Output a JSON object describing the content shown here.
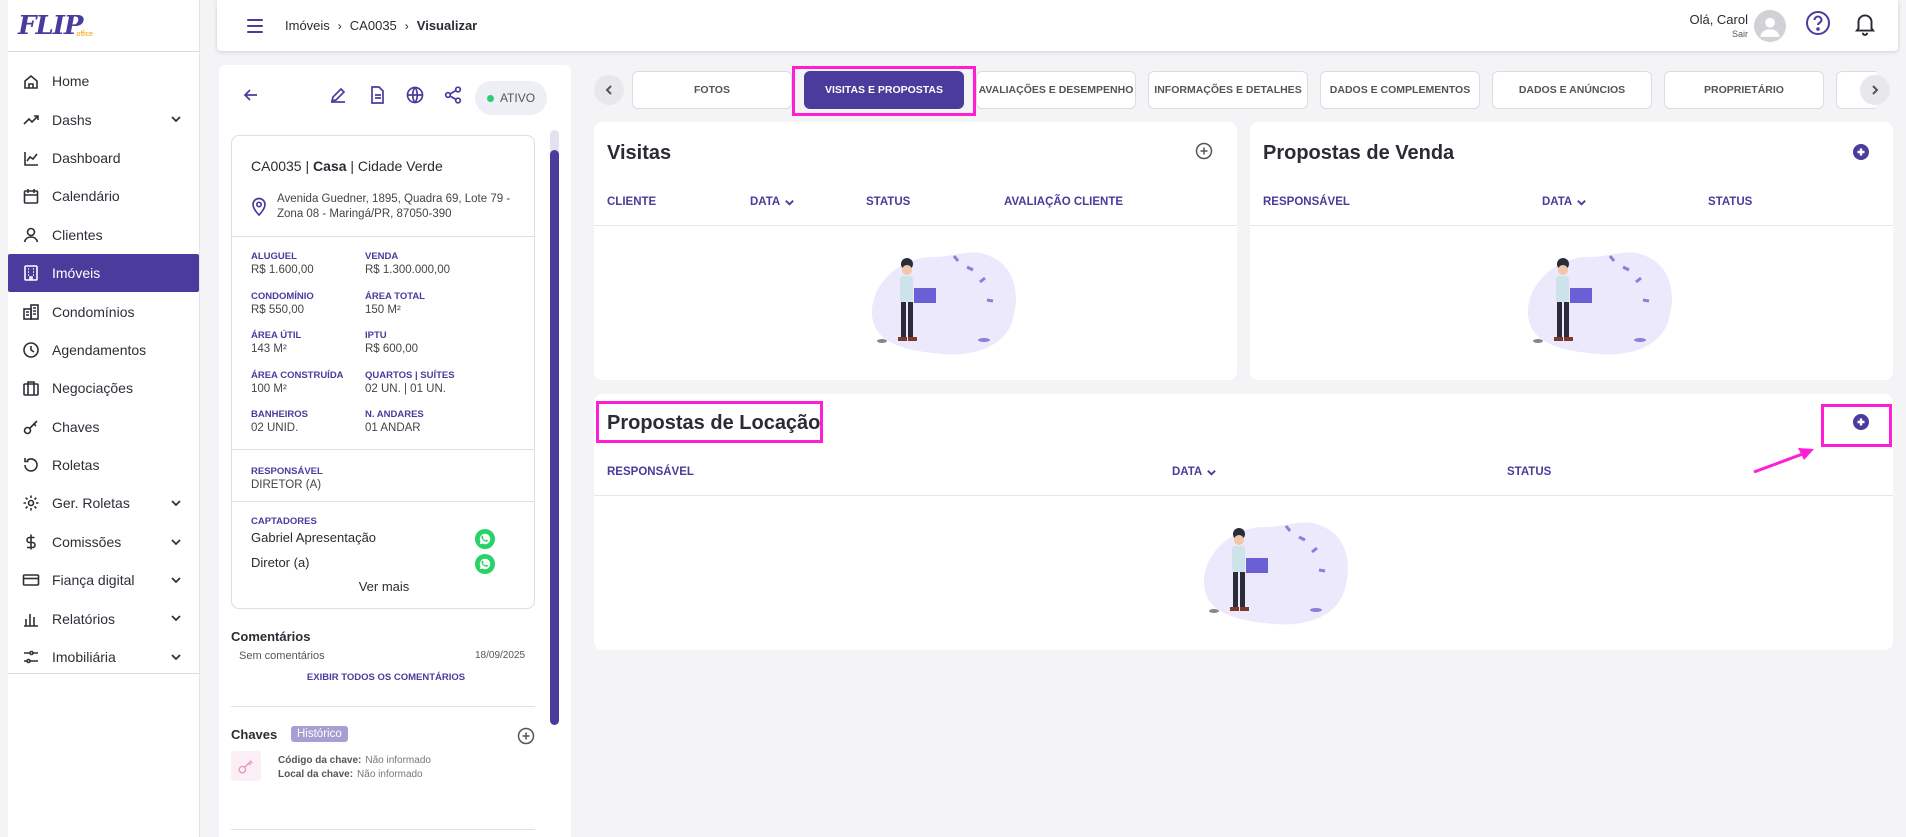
{
  "app": {
    "logo_text": "FLIP",
    "logo_sub": "office"
  },
  "sidebar": {
    "items": [
      {
        "label": "Home",
        "icon": "home-icon",
        "has_submenu": false
      },
      {
        "label": "Dashs",
        "icon": "trend-icon",
        "has_submenu": true
      },
      {
        "label": "Dashboard",
        "icon": "chart-icon",
        "has_submenu": false
      },
      {
        "label": "Calendário",
        "icon": "calendar-icon",
        "has_submenu": false
      },
      {
        "label": "Clientes",
        "icon": "user-icon",
        "has_submenu": false
      },
      {
        "label": "Imóveis",
        "icon": "building-icon",
        "has_submenu": false,
        "active": true
      },
      {
        "label": "Condomínios",
        "icon": "condo-icon",
        "has_submenu": false
      },
      {
        "label": "Agendamentos",
        "icon": "clock-icon",
        "has_submenu": false
      },
      {
        "label": "Negociações",
        "icon": "briefcase-icon",
        "has_submenu": false
      },
      {
        "label": "Chaves",
        "icon": "key-icon",
        "has_submenu": false
      },
      {
        "label": "Roletas",
        "icon": "rotate-icon",
        "has_submenu": false
      },
      {
        "label": "Ger. Roletas",
        "icon": "gear-icon",
        "has_submenu": true
      },
      {
        "label": "Comissões",
        "icon": "dollar-icon",
        "has_submenu": true
      },
      {
        "label": "Fiança digital",
        "icon": "card-icon",
        "has_submenu": true
      },
      {
        "label": "Relatórios",
        "icon": "bar-chart-icon",
        "has_submenu": true
      },
      {
        "label": "Imobiliária",
        "icon": "settings-icon",
        "has_submenu": true
      }
    ]
  },
  "header": {
    "breadcrumb": [
      "Imóveis",
      "CA0035",
      "Visualizar"
    ],
    "greeting": "Olá, Carol",
    "logout": "Sair"
  },
  "property": {
    "status": "ATIVO",
    "code": "CA0035",
    "type": "Casa",
    "condo": "Cidade Verde",
    "address": "Avenida Guedner, 1895, Quadra 69, Lote 79 - Zona 08 - Maringá/PR, 87050-390",
    "attributes": [
      {
        "label": "Aluguel",
        "value": "R$ 1.600,00"
      },
      {
        "label": "Venda",
        "value": "R$ 1.300.000,00"
      },
      {
        "label": "Condomínio",
        "value": "R$ 550,00"
      },
      {
        "label": "Área total",
        "value": "150 M²"
      },
      {
        "label": "Área útil",
        "value": "143 M²"
      },
      {
        "label": "IPTU",
        "value": "R$ 600,00"
      },
      {
        "label": "Área construída",
        "value": "100 M²"
      },
      {
        "label": "Quartos | Suítes",
        "value": "02 UN. | 01 UN."
      },
      {
        "label": "Banheiros",
        "value": "02 UNID."
      },
      {
        "label": "N. Andares",
        "value": "01 ANDAR"
      }
    ],
    "responsavel_label": "RESPONSÁVEL",
    "responsavel": "DIRETOR (A)",
    "captadores_label": "CAPTADORES",
    "captadores": [
      "Gabriel Apresentação",
      "Diretor (a)"
    ],
    "ver_mais": "Ver mais"
  },
  "comments": {
    "title": "Comentários",
    "empty": "Sem comentários",
    "date": "18/09/2025",
    "show_all": "EXIBIR TODOS OS COMENTÁRIOS"
  },
  "keys": {
    "title": "Chaves",
    "history_badge": "Histórico",
    "code_label": "Código da chave:",
    "code_value": "Não informado",
    "local_label": "Local da chave:",
    "local_value": "Não informado"
  },
  "tabs": [
    {
      "label": "FOTOS"
    },
    {
      "label": "VISITAS E PROPOSTAS",
      "active": true
    },
    {
      "label": "AVALIAÇÕES E DESEMPENHO"
    },
    {
      "label": "INFORMAÇÕES E DETALHES"
    },
    {
      "label": "DADOS E COMPLEMENTOS"
    },
    {
      "label": "DADOS E ANÚNCIOS"
    },
    {
      "label": "PROPRIETÁRIO"
    }
  ],
  "visitas": {
    "title": "Visitas",
    "columns": [
      "CLIENTE",
      "DATA",
      "STATUS",
      "AVALIAÇÃO CLIENTE"
    ]
  },
  "propostas_venda": {
    "title": "Propostas de Venda",
    "columns": [
      "RESPONSÁVEL",
      "DATA",
      "STATUS"
    ]
  },
  "propostas_locacao": {
    "title": "Propostas de Locação",
    "columns": [
      "RESPONSÁVEL",
      "DATA",
      "STATUS"
    ]
  },
  "colors": {
    "accent": "#4b3b9c",
    "highlight": "#ff1dd6",
    "whatsapp": "#25d366"
  }
}
